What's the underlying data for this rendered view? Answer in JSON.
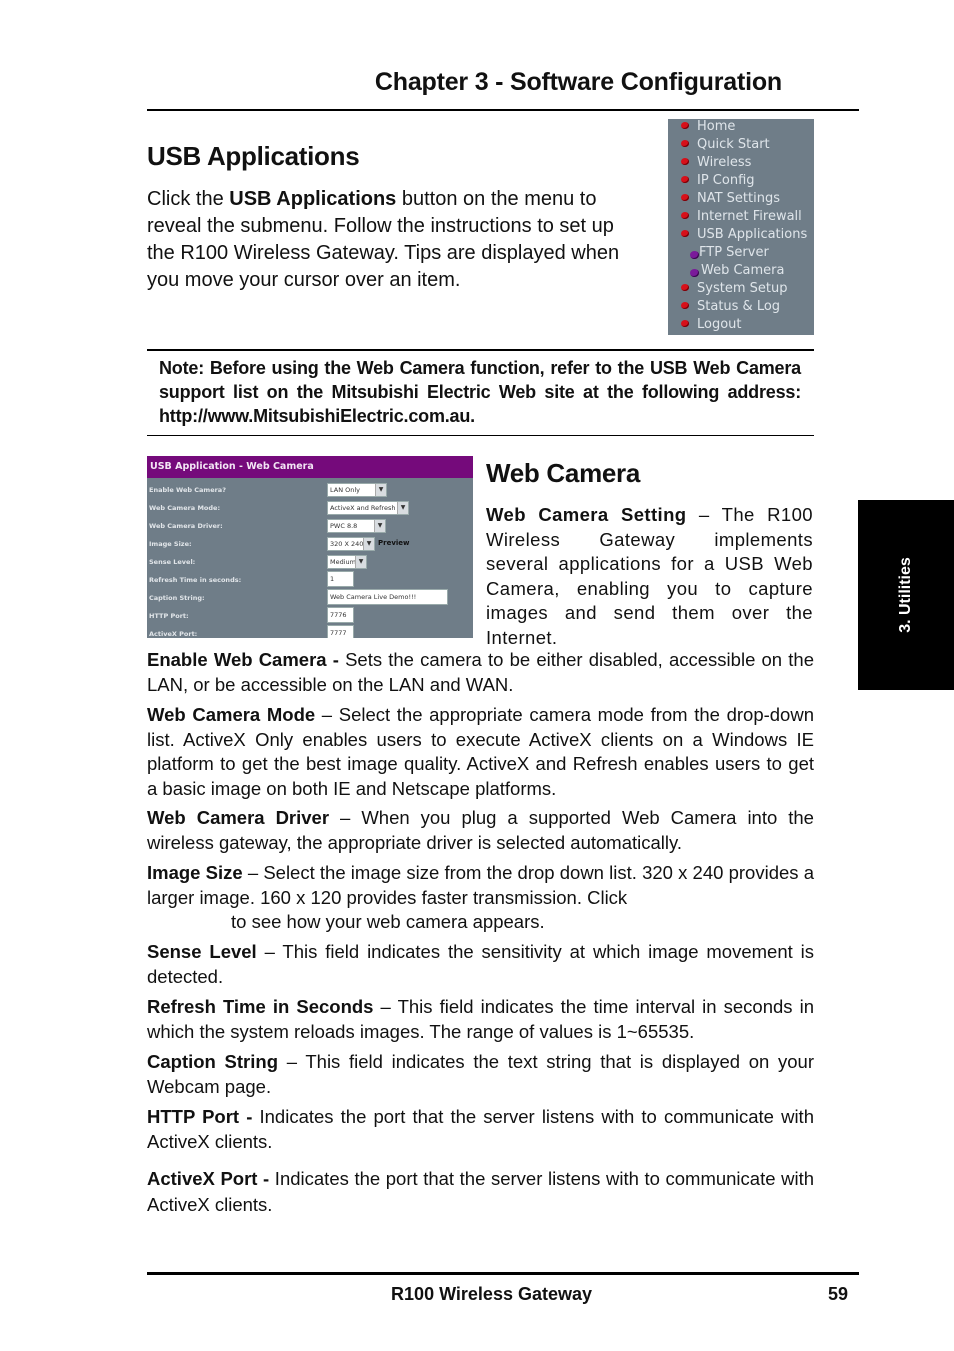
{
  "header": {
    "chapter_title": "Chapter 3 - Software Configuration"
  },
  "usb_section": {
    "heading": "USB Applications",
    "intro_prefix": "Click the ",
    "intro_bold": "USB Applications",
    "intro_suffix": " button on the menu to reveal the submenu. Follow the instructions to set up the R100 Wireless Gateway. Tips are displayed when you move your cursor over an item."
  },
  "router_menu": {
    "items": [
      {
        "label": "Home",
        "icon": "red-bullet-icon",
        "level": 0
      },
      {
        "label": "Quick Start",
        "icon": "red-bullet-icon",
        "level": 0
      },
      {
        "label": "Wireless",
        "icon": "red-bullet-icon",
        "level": 0
      },
      {
        "label": "IP Config",
        "icon": "red-bullet-icon",
        "level": 0
      },
      {
        "label": "NAT Settings",
        "icon": "red-bullet-icon",
        "level": 0
      },
      {
        "label": "Internet Firewall",
        "icon": "red-bullet-icon",
        "level": 0
      },
      {
        "label": "USB Applications",
        "icon": "red-bullet-icon",
        "level": 0
      },
      {
        "label": "FTP Server",
        "icon": "purple-bullet-icon",
        "level": 1
      },
      {
        "label": "Web Camera",
        "icon": "purple-bullet-icon",
        "level": 1
      },
      {
        "label": "System Setup",
        "icon": "red-bullet-icon",
        "level": 0
      },
      {
        "label": "Status & Log",
        "icon": "red-bullet-icon",
        "level": 0
      },
      {
        "label": "Logout",
        "icon": "red-bullet-icon",
        "level": 0
      }
    ]
  },
  "note": {
    "text": "Note: Before using the Web Camera function, refer to the USB Web Camera support list on the Mitsubishi Electric Web site at the following address: http://www.MitsubishiElectric.com.au."
  },
  "webcam_form": {
    "title": "USB Application - Web Camera",
    "rows": [
      {
        "label": "Enable Web Camera?",
        "type": "select",
        "value": "LAN Only"
      },
      {
        "label": "Web Camera Mode:",
        "type": "select",
        "value": "ActiveX and Refresh"
      },
      {
        "label": "Web Camera Driver:",
        "type": "select",
        "value": "PWC 8.8"
      },
      {
        "label": "Image Size:",
        "type": "select",
        "value": "320 X 240"
      },
      {
        "label": "Sense Level:",
        "type": "select",
        "value": "Medium"
      },
      {
        "label": "Refresh Time in seconds:",
        "type": "text",
        "value": "1"
      },
      {
        "label": "Caption String:",
        "type": "text",
        "value": "Web Camera Live Demo!!!"
      },
      {
        "label": "HTTP Port:",
        "type": "text",
        "value": "7776"
      },
      {
        "label": "ActiveX Port:",
        "type": "text",
        "value": "7777"
      }
    ],
    "preview_link": "Preview",
    "dropdown_arrow": "▼"
  },
  "webcam_section": {
    "heading": "Web Camera",
    "intro_bold": "Web Camera Setting",
    "intro_text": " – The R100 Wireless Gateway implements several applications for a USB Web Camera, enabling you to capture images and send them over the Internet."
  },
  "paragraphs": [
    {
      "term": "Enable Web Camera -",
      "text": " Sets the camera to be either disabled, accessible on the LAN, or be accessible on the LAN and WAN."
    },
    {
      "term": "Web Camera Mode",
      "text": " – Select the appropriate camera mode from the drop-down list. ActiveX Only enables users to execute ActiveX clients on a Windows IE platform to get the best image quality. ActiveX and Refresh enables users to get a basic image on both IE and Netscape platforms."
    },
    {
      "term": "Web Camera Driver",
      "text": " – When you plug a supported Web Camera into the wireless gateway, the appropriate driver is selected automatically."
    },
    {
      "term": "Image Size",
      "text": " – Select the image size from the drop down list. 320 x 240 provides a larger image. 160 x 120 provides faster transmission. Click",
      "text2": "to see how your web camera appears."
    },
    {
      "term": "Sense Level",
      "text": " – This field indicates the sensitivity at which image movement is detected."
    },
    {
      "term": "Refresh Time in Seconds",
      "text": " – This field indicates the time interval in seconds in which the system reloads images. The range of values is 1~65535."
    },
    {
      "term": "Caption String",
      "text": " – This field indicates the text string that is displayed on your Webcam page."
    },
    {
      "term": "HTTP Port -",
      "text": " Indicates the port that the server listens with to communicate with ActiveX clients."
    },
    {
      "term": "ActiveX Port -",
      "text": " Indicates the port that the server listens with to communicate with ActiveX clients."
    }
  ],
  "side_tab": {
    "label": "3. Utilities"
  },
  "footer": {
    "title": "R100 Wireless Gateway",
    "page_number": "59"
  }
}
